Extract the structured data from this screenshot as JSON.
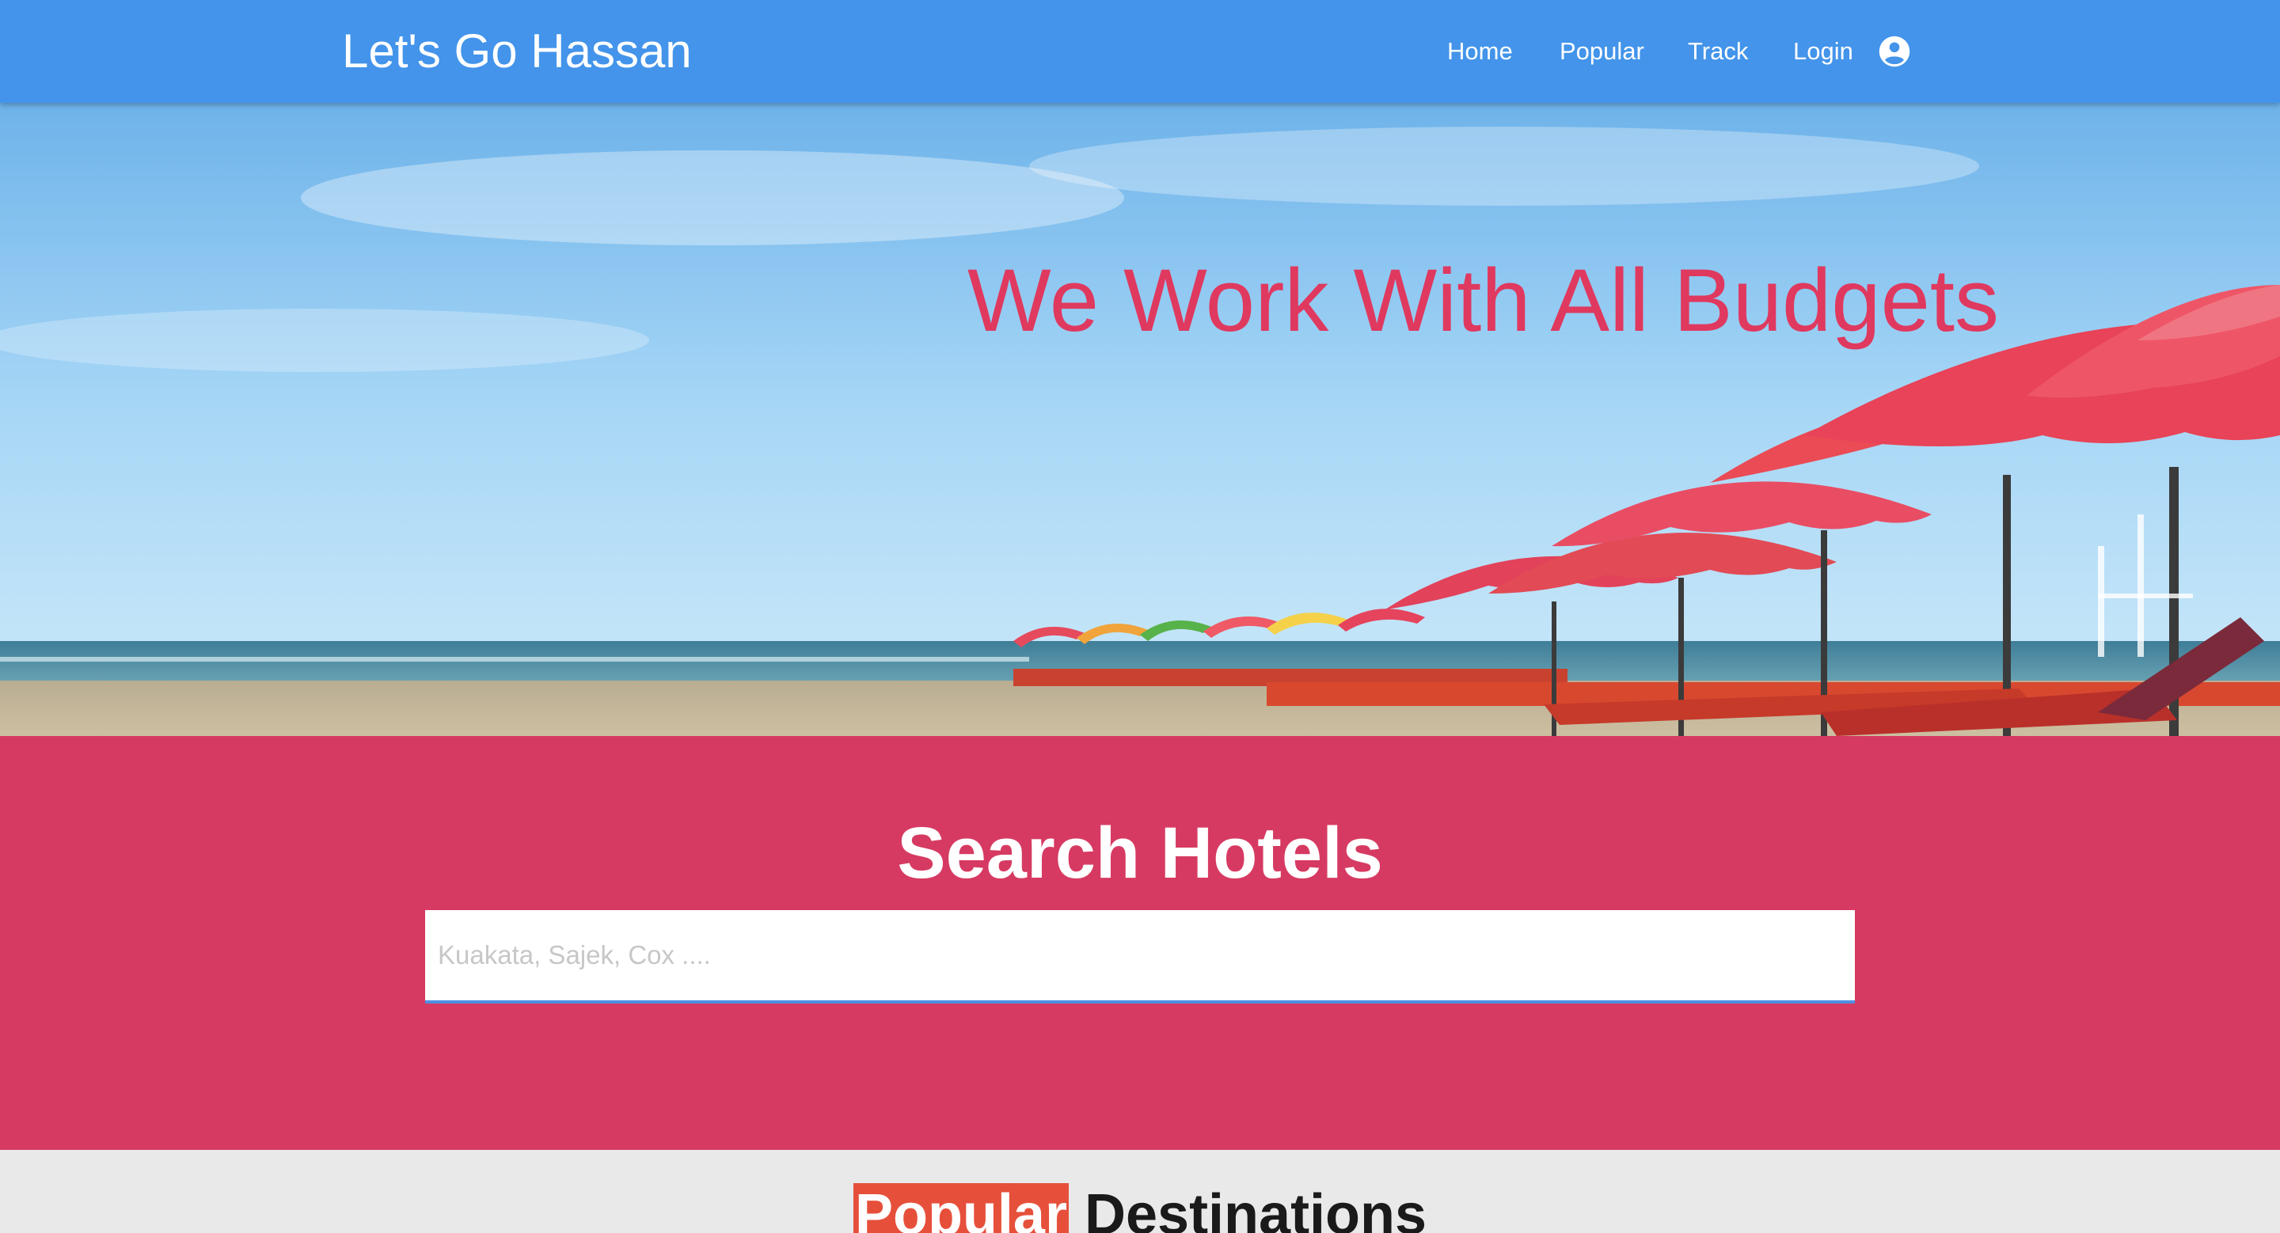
{
  "nav": {
    "brand": "Let's Go Hassan",
    "links": [
      "Home",
      "Popular",
      "Track",
      "Login"
    ],
    "account_icon": "account-circle-icon"
  },
  "hero": {
    "title": "We Work With All Budgets"
  },
  "search": {
    "title": "Search Hotels",
    "placeholder": "Kuakata, Sajek, Cox ...."
  },
  "popular": {
    "highlight": "Popular",
    "rest": "Destinations"
  },
  "colors": {
    "navbar": "#4394ea",
    "hero_title": "#e0395f",
    "search_bg": "#d63a62",
    "popular_highlight": "#e6503b"
  }
}
